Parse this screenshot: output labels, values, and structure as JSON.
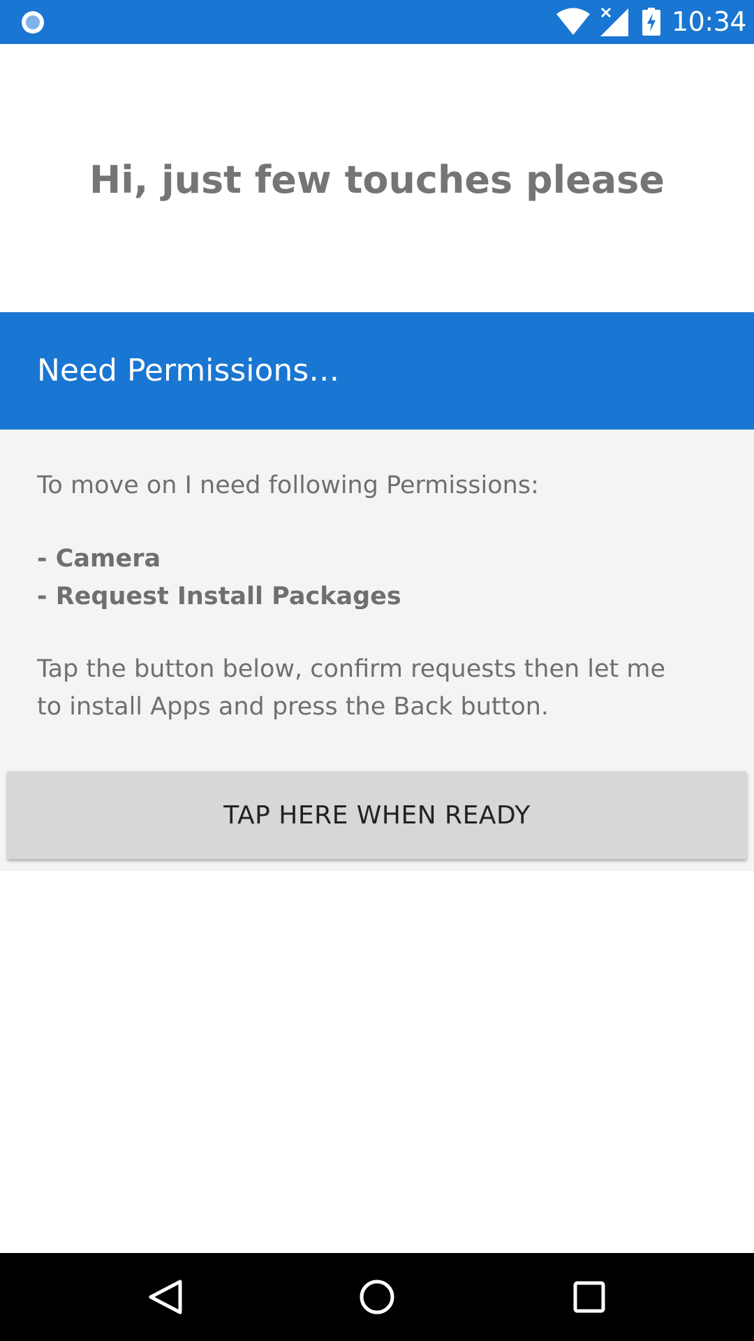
{
  "status_bar": {
    "time": "10:34",
    "icons": [
      "notification-dot-icon",
      "wifi-icon",
      "signal-no-data-icon",
      "battery-charging-icon"
    ],
    "color": "#1976d2"
  },
  "greeting": "Hi, just few touches please",
  "permissions_header": {
    "title": "Need Permissions…",
    "color": "#1976d2"
  },
  "content": {
    "intro": "To move on I need following Permissions:",
    "permissions": [
      "- Camera",
      "- Request Install Packages"
    ],
    "instructions": "Tap the button below, confirm requests then let me to install Apps and press the Back button."
  },
  "ready_button_label": "TAP HERE WHEN READY",
  "nav_bar": {
    "buttons": [
      "back-icon",
      "home-icon",
      "recents-icon"
    ]
  }
}
